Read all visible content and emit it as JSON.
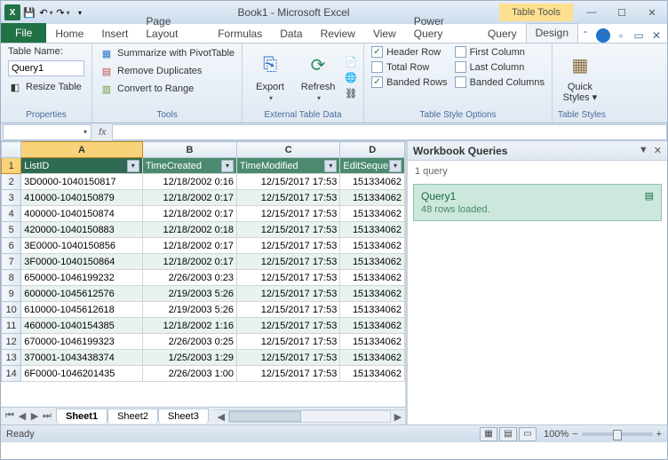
{
  "title": "Book1 - Microsoft Excel",
  "context_tab": "Table Tools",
  "tabs": {
    "file": "File",
    "home": "Home",
    "insert": "Insert",
    "page": "Page Layout",
    "formulas": "Formulas",
    "data": "Data",
    "review": "Review",
    "view": "View",
    "pq": "Power Query",
    "query": "Query",
    "design": "Design"
  },
  "ribbon": {
    "properties": {
      "label": "Properties",
      "tablename_label": "Table Name:",
      "tablename_value": "Query1",
      "resize": "Resize Table"
    },
    "tools": {
      "label": "Tools",
      "pivot": "Summarize with PivotTable",
      "dup": "Remove Duplicates",
      "range": "Convert to Range"
    },
    "external": {
      "label": "External Table Data",
      "export": "Export",
      "refresh": "Refresh"
    },
    "styleopts": {
      "label": "Table Style Options",
      "hr": "Header Row",
      "tr": "Total Row",
      "br": "Banded Rows",
      "fc": "First Column",
      "lc": "Last Column",
      "bc": "Banded Columns"
    },
    "styles": {
      "label": "Table Styles",
      "quick": "Quick\nStyles"
    }
  },
  "formula": {
    "fx": "fx"
  },
  "columns": [
    "A",
    "B",
    "C",
    "D"
  ],
  "headers": [
    "ListID",
    "TimeCreated",
    "TimeModified",
    "EditSeque"
  ],
  "rows": [
    [
      "3D0000-1040150817",
      "12/18/2002 0:16",
      "12/15/2017 17:53",
      "151334062"
    ],
    [
      "410000-1040150879",
      "12/18/2002 0:17",
      "12/15/2017 17:53",
      "151334062"
    ],
    [
      "400000-1040150874",
      "12/18/2002 0:17",
      "12/15/2017 17:53",
      "151334062"
    ],
    [
      "420000-1040150883",
      "12/18/2002 0:18",
      "12/15/2017 17:53",
      "151334062"
    ],
    [
      "3E0000-1040150856",
      "12/18/2002 0:17",
      "12/15/2017 17:53",
      "151334062"
    ],
    [
      "3F0000-1040150864",
      "12/18/2002 0:17",
      "12/15/2017 17:53",
      "151334062"
    ],
    [
      "650000-1046199232",
      "2/26/2003 0:23",
      "12/15/2017 17:53",
      "151334062"
    ],
    [
      "600000-1045612576",
      "2/19/2003 5:26",
      "12/15/2017 17:53",
      "151334062"
    ],
    [
      "610000-1045612618",
      "2/19/2003 5:26",
      "12/15/2017 17:53",
      "151334062"
    ],
    [
      "460000-1040154385",
      "12/18/2002 1:16",
      "12/15/2017 17:53",
      "151334062"
    ],
    [
      "670000-1046199323",
      "2/26/2003 0:25",
      "12/15/2017 17:53",
      "151334062"
    ],
    [
      "370001-1043438374",
      "1/25/2003 1:29",
      "12/15/2017 17:53",
      "151334062"
    ],
    [
      "6F0000-1046201435",
      "2/26/2003 1:00",
      "12/15/2017 17:53",
      "151334062"
    ]
  ],
  "sheets": [
    "Sheet1",
    "Sheet2",
    "Sheet3"
  ],
  "pane": {
    "title": "Workbook Queries",
    "count": "1 query",
    "qname": "Query1",
    "qstatus": "48 rows loaded."
  },
  "status": {
    "ready": "Ready",
    "zoom": "100%"
  }
}
